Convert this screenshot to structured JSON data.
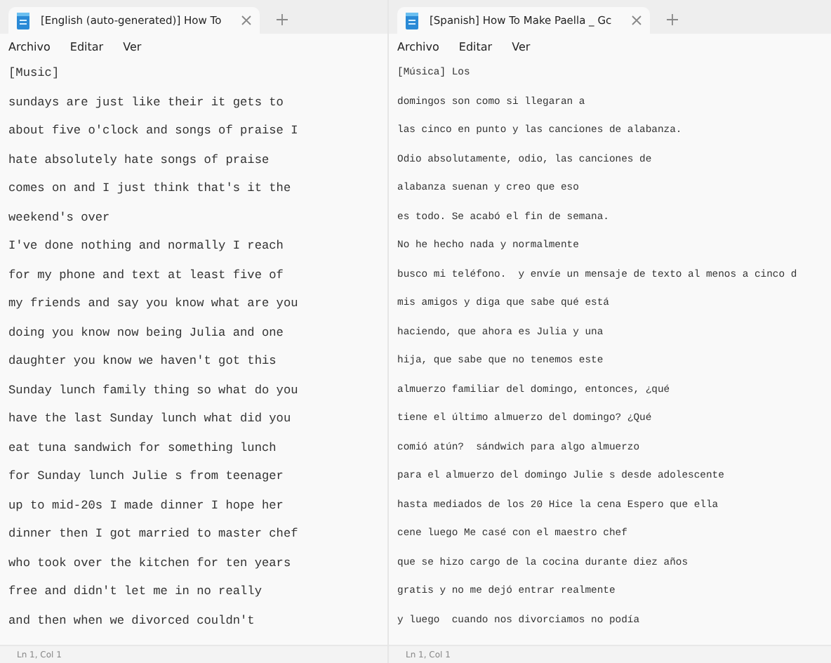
{
  "windows": [
    {
      "tab": {
        "title": "[English (auto-generated)] How To"
      },
      "menu": [
        "Archivo",
        "Editar",
        "Ver"
      ],
      "kind": "large",
      "lines": [
        "[Music]",
        "sundays are just like their it gets to",
        "about five o'clock and songs of praise I",
        "hate absolutely hate songs of praise",
        "comes on and I just think that's it the",
        "weekend's over",
        "I've done nothing and normally I reach",
        "for my phone and text at least five of",
        "my friends and say you know what are you",
        "doing you know now being Julia and one",
        "daughter you know we haven't got this",
        "Sunday lunch family thing so what do you",
        "have the last Sunday lunch what did you",
        "eat tuna sandwich for something lunch",
        "for Sunday lunch Julie s from teenager",
        "up to mid-20s I made dinner I hope her",
        "dinner then I got married to master chef",
        "who took over the kitchen for ten years",
        "free and didn't let me in no really",
        "and then when we divorced couldn't"
      ],
      "status": "Ln 1, Col 1"
    },
    {
      "tab": {
        "title": "[Spanish] How To Make Paella _ Gc"
      },
      "menu": [
        "Archivo",
        "Editar",
        "Ver"
      ],
      "kind": "small",
      "lines": [
        "[Música] Los",
        "domingos son como si llegaran a",
        "las cinco en punto y las canciones de alabanza.",
        "Odio absolutamente, odio, las canciones de",
        "alabanza suenan y creo que eso",
        "es todo. Se acabó el fin de semana.",
        "No he hecho nada y normalmente",
        "busco mi teléfono.  y envíe un mensaje de texto al menos a cinco d",
        "mis amigos y diga que sabe qué está",
        "haciendo, que ahora es Julia y una",
        "hija, que sabe que no tenemos este",
        "almuerzo familiar del domingo, entonces, ¿qué",
        "tiene el último almuerzo del domingo? ¿Qué",
        "comió atún?  sándwich para algo almuerzo",
        "para el almuerzo del domingo Julie s desde adolescente",
        "hasta mediados de los 20 Hice la cena Espero que ella",
        "cene luego Me casé con el maestro chef",
        "que se hizo cargo de la cocina durante diez años",
        "gratis y no me dejó entrar realmente",
        "y luego  cuando nos divorciamos no podía"
      ],
      "status": "Ln 1, Col 1"
    }
  ]
}
